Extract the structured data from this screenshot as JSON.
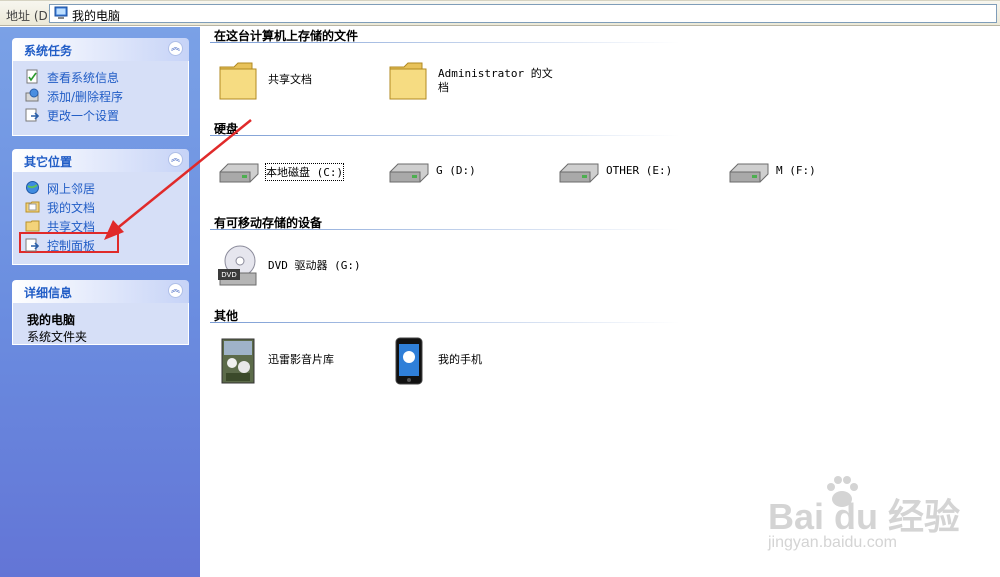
{
  "address_bar": {
    "label": "地址 (D)",
    "location": "我的电脑"
  },
  "task_pane": {
    "system_tasks": {
      "title": "系统任务",
      "items": [
        {
          "label": "查看系统信息",
          "icon": "system-info-icon"
        },
        {
          "label": "添加/删除程序",
          "icon": "add-remove-programs-icon"
        },
        {
          "label": "更改一个设置",
          "icon": "change-setting-icon"
        }
      ]
    },
    "other_places": {
      "title": "其它位置",
      "items": [
        {
          "label": "网上邻居",
          "icon": "network-places-icon"
        },
        {
          "label": "我的文档",
          "icon": "my-documents-icon"
        },
        {
          "label": "共享文档",
          "icon": "shared-documents-icon"
        },
        {
          "label": "控制面板",
          "icon": "control-panel-icon"
        }
      ]
    },
    "details": {
      "title": "详细信息",
      "name": "我的电脑",
      "description": "系统文件夹"
    }
  },
  "main": {
    "groups": [
      {
        "title": "在这台计算机上存储的文件",
        "items": [
          "共享文档",
          "Administrator 的文",
          "档"
        ]
      },
      {
        "title": "硬盘",
        "items": [
          "本地磁盘 (C:)",
          "G (D:)",
          "OTHER (E:)",
          "M (F:)"
        ]
      },
      {
        "title": "有可移动存储的设备",
        "items": [
          "DVD 驱动器 (G:)"
        ]
      },
      {
        "title": "其他",
        "items": [
          "迅雷影音片库",
          "我的手机"
        ]
      }
    ]
  },
  "watermark": {
    "brand": "Bai du 经验",
    "url": "jingyan.baidu.com"
  },
  "colors": {
    "taskpane_link": "#215dc6",
    "highlight": "#e02a2a"
  }
}
